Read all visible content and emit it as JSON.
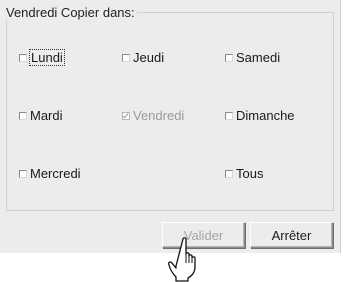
{
  "dialog": {
    "group_title": "Vendredi Copier dans:",
    "days": [
      {
        "label": "Lundi",
        "checked": false,
        "enabled": true,
        "focused": true
      },
      {
        "label": "Jeudi",
        "checked": false,
        "enabled": true,
        "focused": false
      },
      {
        "label": "Samedi",
        "checked": false,
        "enabled": true,
        "focused": false
      },
      {
        "label": "Mardi",
        "checked": false,
        "enabled": true,
        "focused": false
      },
      {
        "label": "Vendredi",
        "checked": true,
        "enabled": false,
        "focused": false
      },
      {
        "label": "Dimanche",
        "checked": false,
        "enabled": true,
        "focused": false
      },
      {
        "label": "Mercredi",
        "checked": false,
        "enabled": true,
        "focused": false
      },
      {
        "label": "Tous",
        "checked": false,
        "enabled": true,
        "focused": false
      }
    ],
    "buttons": {
      "validate_label": "Valider",
      "validate_enabled": false,
      "stop_label": "Arrêter"
    }
  },
  "cursor": {
    "icon": "hand-pointer-icon"
  },
  "colors": {
    "dialog_bg": "#ececec",
    "disabled_text": "#9a9a9a"
  }
}
